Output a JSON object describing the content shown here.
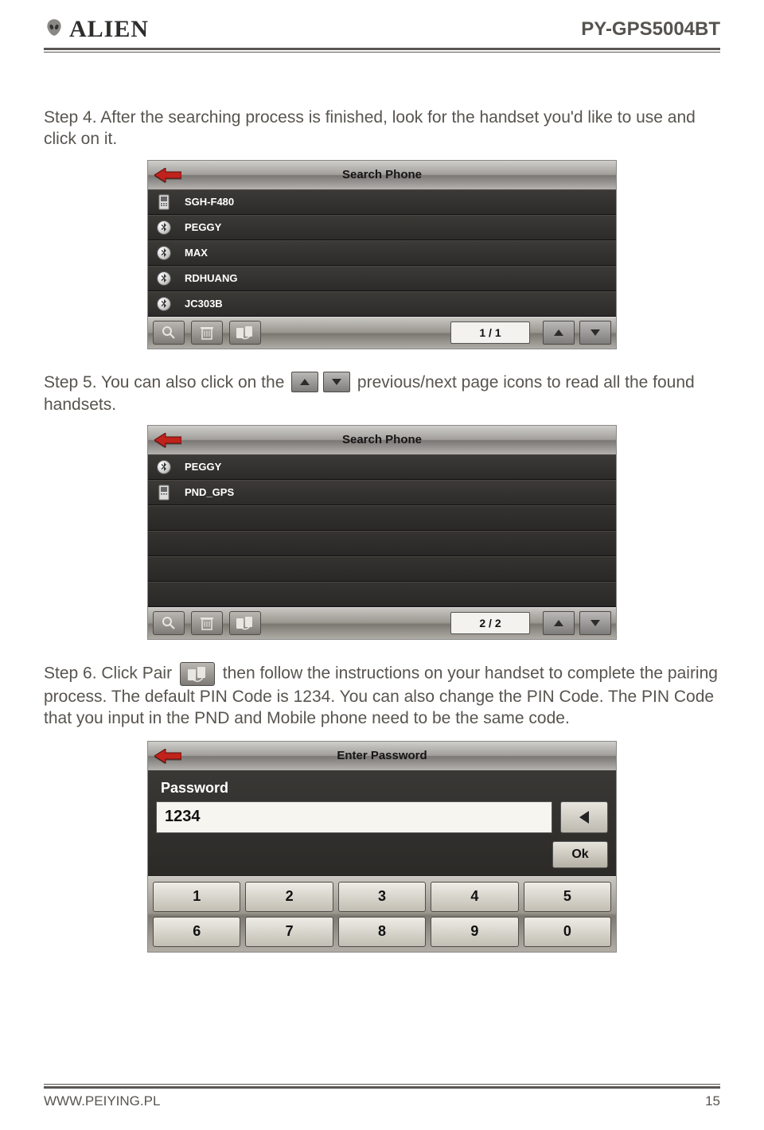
{
  "header": {
    "brand": "ALIEN",
    "model": "PY-GPS5004BT"
  },
  "step4": {
    "text": "Step 4. After the searching process is finished, look for the handset you'd like to use and click on it."
  },
  "screen1": {
    "title": "Search Phone",
    "items": [
      {
        "type": "phone",
        "name": "SGH-F480"
      },
      {
        "type": "bt",
        "name": "PEGGY"
      },
      {
        "type": "bt",
        "name": "MAX"
      },
      {
        "type": "bt",
        "name": "RDHUANG"
      },
      {
        "type": "bt",
        "name": "JC303B"
      }
    ],
    "page": "1 / 1"
  },
  "step5": {
    "before": "Step 5. You can also click on the",
    "after": "previous/next page icons to read all the found handsets."
  },
  "screen2": {
    "title": "Search Phone",
    "items": [
      {
        "type": "bt",
        "name": "PEGGY"
      },
      {
        "type": "phone",
        "name": "PND_GPS"
      }
    ],
    "empty_rows": 4,
    "page": "2 / 2"
  },
  "step6": {
    "before": "Step 6. Click Pair",
    "after": "then follow the instructions on your handset to complete the pairing process. The default PIN Code is 1234. You can also change the PIN Code. The PIN Code that you input in the PND and Mobile phone need to be the same code."
  },
  "pw": {
    "title": "Enter Password",
    "label": "Password",
    "value": "1234",
    "ok": "Ok",
    "keys": [
      "1",
      "2",
      "3",
      "4",
      "5",
      "6",
      "7",
      "8",
      "9",
      "0"
    ]
  },
  "footer": {
    "url": "WWW.PEIYING.PL",
    "page": "15"
  }
}
